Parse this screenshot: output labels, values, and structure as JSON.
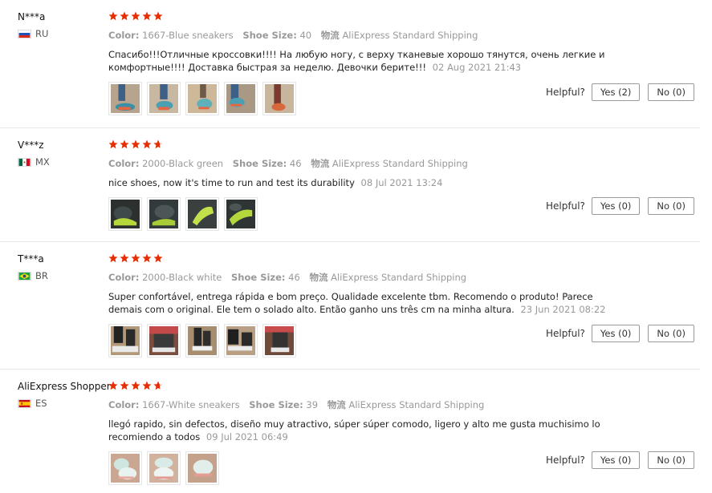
{
  "star_color": "#e62e04",
  "helpful_label": "Helpful?",
  "reviews": [
    {
      "user": "N***a",
      "country": "RU",
      "flag": "flag-russia",
      "stars": 5,
      "color_label": "Color:",
      "color": "1667-Blue sneakers",
      "size_label": "Shoe Size:",
      "size": "40",
      "shipping_label": "物流",
      "shipping": "AliExpress Standard Shipping",
      "text": "Спасибо!!!Отличные кроссовки!!!! На любую ногу, с верху тканевые хорошо тянутся, очень легкие и комфортные!!!! Доставка быстрая за неделю. Девочки берите!!!",
      "date": "02 Aug 2021 21:43",
      "thumb_count": 5,
      "yes_label": "Yes (2)",
      "no_label": "No (0)"
    },
    {
      "user": "V***z",
      "country": "MX",
      "flag": "flag-mexico",
      "stars": 4.5,
      "color_label": "Color:",
      "color": "2000-Black green",
      "size_label": "Shoe Size:",
      "size": "46",
      "shipping_label": "物流",
      "shipping": "AliExpress Standard Shipping",
      "text": "nice shoes, now it's time to run and test its durability",
      "date": "08 Jul 2021 13:24",
      "thumb_count": 4,
      "yes_label": "Yes (0)",
      "no_label": "No (0)"
    },
    {
      "user": "T***a",
      "country": "BR",
      "flag": "flag-brazil",
      "stars": 5,
      "color_label": "Color:",
      "color": "2000-Black white",
      "size_label": "Shoe Size:",
      "size": "46",
      "shipping_label": "物流",
      "shipping": "AliExpress Standard Shipping",
      "text": "Super confortável, entrega rápida e bom preço. Qualidade excelente tbm. Recomendo o produto! Parece demais com o original. Ele tem o solado alto. Então ganho uns três cm na minha altura.",
      "date": "23 Jun 2021 08:22",
      "thumb_count": 5,
      "yes_label": "Yes (0)",
      "no_label": "No (0)"
    },
    {
      "user": "AliExpress Shopper",
      "country": "ES",
      "flag": "flag-spain",
      "stars": 4.5,
      "color_label": "Color:",
      "color": "1667-White sneakers",
      "size_label": "Shoe Size:",
      "size": "39",
      "shipping_label": "物流",
      "shipping": "AliExpress Standard Shipping",
      "text": "llegó rapido, sin defectos, diseño muy atractivo, súper súper comodo, ligero y alto me gusta muchisimo lo recomiendo a todos",
      "date": "09 Jul 2021 06:49",
      "thumb_count": 3,
      "yes_label": "Yes (0)",
      "no_label": "No (0)"
    }
  ]
}
